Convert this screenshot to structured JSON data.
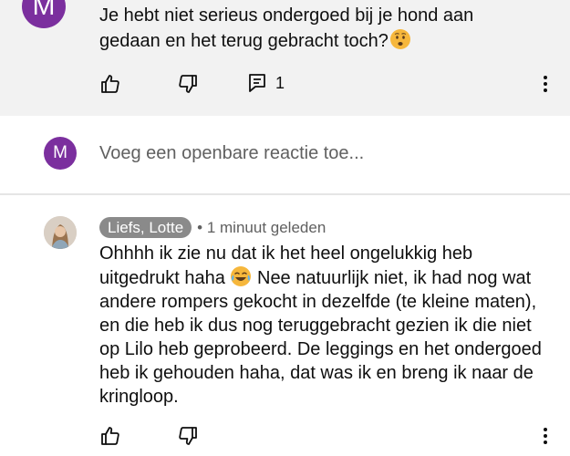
{
  "top_comment": {
    "avatar_letter": "M",
    "text": "Je hebt niet serieus ondergoed bij je hond aan gedaan en het terug gebracht toch?",
    "emoji": "worried-face-emoji",
    "reply_count": "1"
  },
  "reply_box": {
    "avatar_letter": "M",
    "placeholder": "Voeg een openbare reactie toe..."
  },
  "reply": {
    "author": "Liefs, Lotte",
    "time": "• 1 minuut geleden",
    "text_part1": "Ohhhh ik zie nu dat ik het heel ongelukkig heb uitgedrukt haha ",
    "emoji": "face-with-tears-of-joy-emoji",
    "text_part2": " Nee natuurlijk niet, ik had nog wat andere rompers gekocht in dezelfde (te kleine maten), en die heb ik dus nog teruggebracht gezien ik die niet op Lilo heb geprobeerd. De leggings en het ondergoed heb ik gehouden haha, dat was ik en breng ik naar de kringloop."
  },
  "colors": {
    "top_background": "#f2f2f2",
    "avatar": "#7b2f9e",
    "author_chip": "#8a8a8a",
    "secondary_text": "#606060"
  }
}
